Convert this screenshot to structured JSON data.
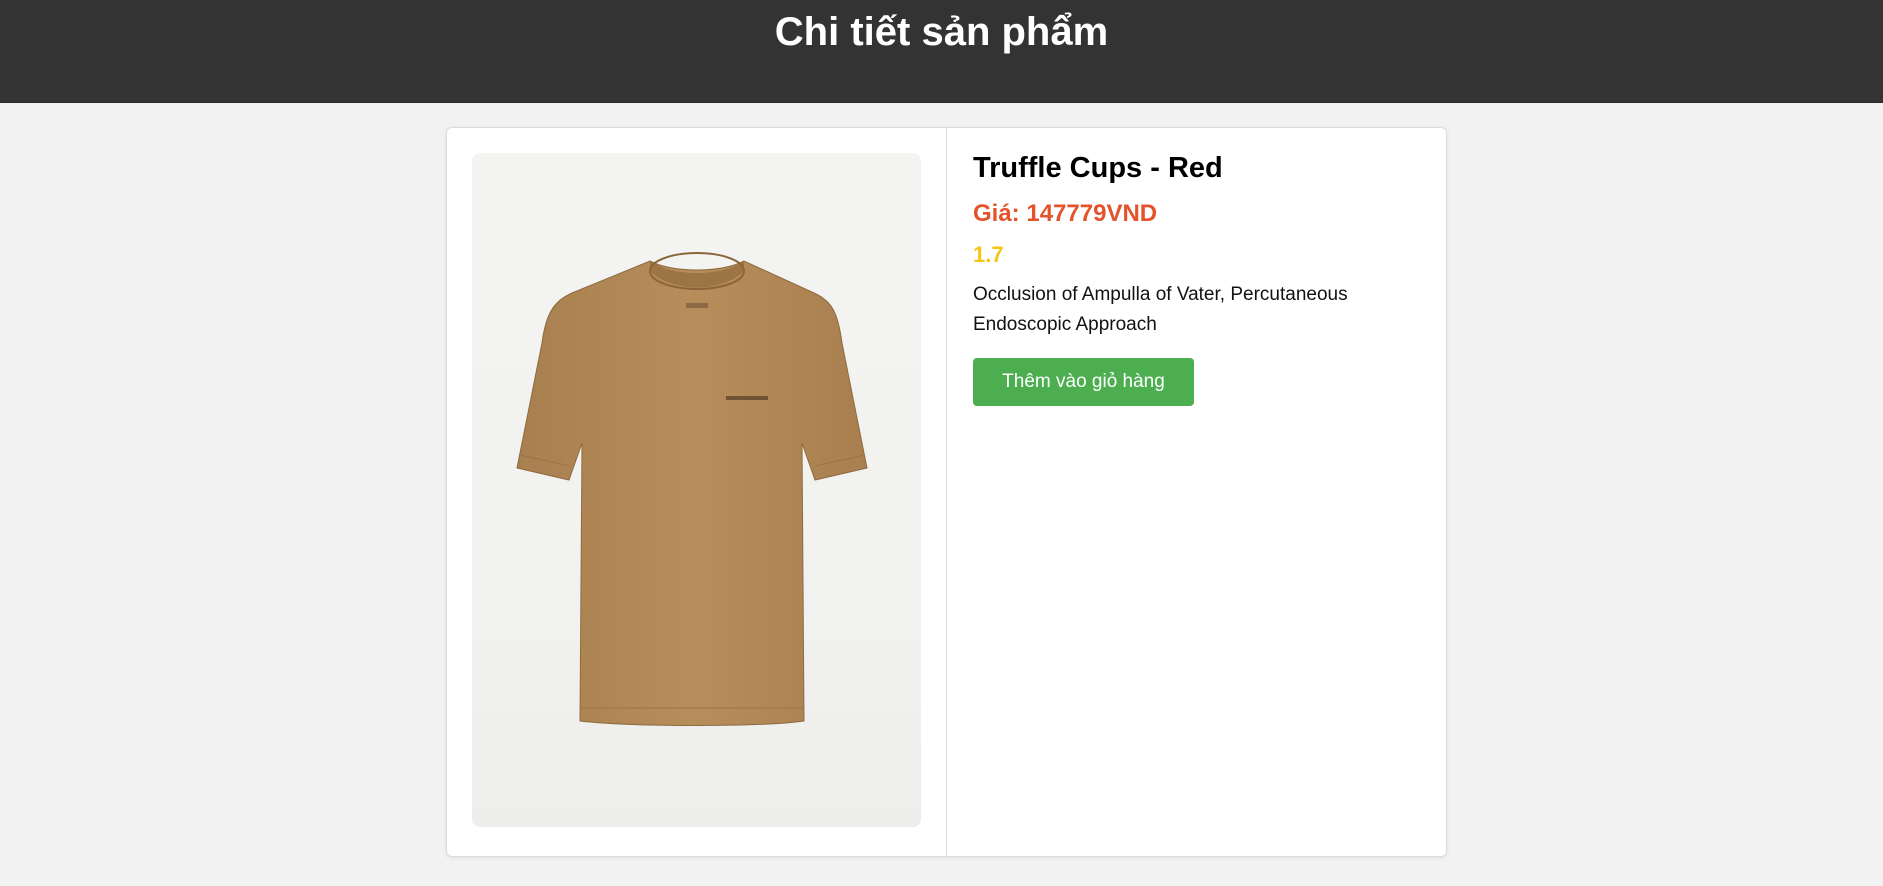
{
  "header": {
    "title": "Chi tiết sản phẩm"
  },
  "product": {
    "name": "Truffle Cups - Red",
    "price_label": "Giá:",
    "price_value": "147779VND",
    "rating": "1.7",
    "description": "Occlusion of Ampulla of Vater, Percutaneous Endoscopic Approach",
    "image_alt": "Tan t-shirt product photo"
  },
  "actions": {
    "add_to_cart_label": "Thêm vào giỏ hàng"
  },
  "colors": {
    "header_bg": "#333333",
    "price": "#e4532c",
    "rating": "#f5c518",
    "button_bg": "#4cae4f",
    "shirt": "#b38a58"
  }
}
